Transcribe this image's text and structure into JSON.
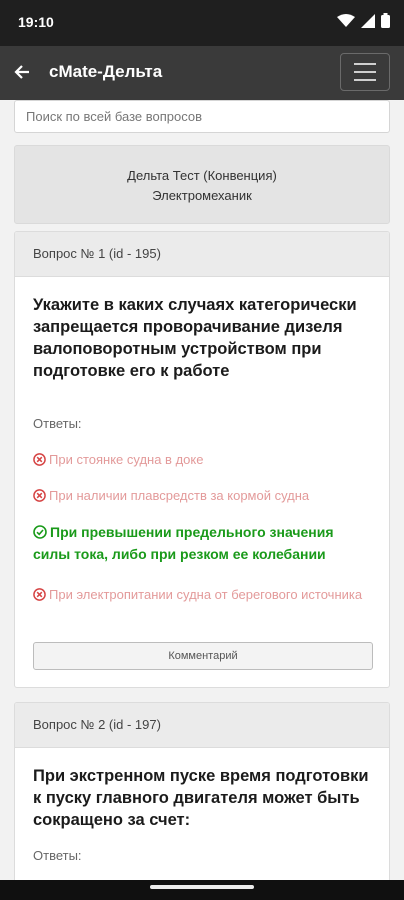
{
  "status": {
    "time": "19:10"
  },
  "app": {
    "title": "cMate-Дельта"
  },
  "search": {
    "placeholder": "Поиск по всей базе вопросов"
  },
  "test_info": {
    "line1": "Дельта Тест (Конвенция)",
    "line2": "Электромеханик"
  },
  "answers_label": "Ответы:",
  "questions": [
    {
      "header": "Вопрос № 1 (id - 195)",
      "text": "Укажите в каких случаях категорически запрещается проворачивание дизеля валоповоротным устройством при подготовке его к работе",
      "answers": [
        {
          "text": "При стоянке судна в доке",
          "correct": false
        },
        {
          "text": "При наличии плавсредств за кормой судна",
          "correct": false
        },
        {
          "text": "При превышении предельного значения силы тока, либо при резком ее колебании",
          "correct": true
        },
        {
          "text": "При электропитании судна от берегового источника",
          "correct": false
        }
      ],
      "comment_label": "Комментарий"
    },
    {
      "header": "Вопрос № 2 (id - 197)",
      "text": "При экстренном пуске время подготовки к пуску главного двигателя может быть сокращено за счет:",
      "answers": []
    }
  ],
  "colors": {
    "correct": "#1a9a1a",
    "wrong": "#e39a9a",
    "app_bar": "#3a3a3a"
  }
}
